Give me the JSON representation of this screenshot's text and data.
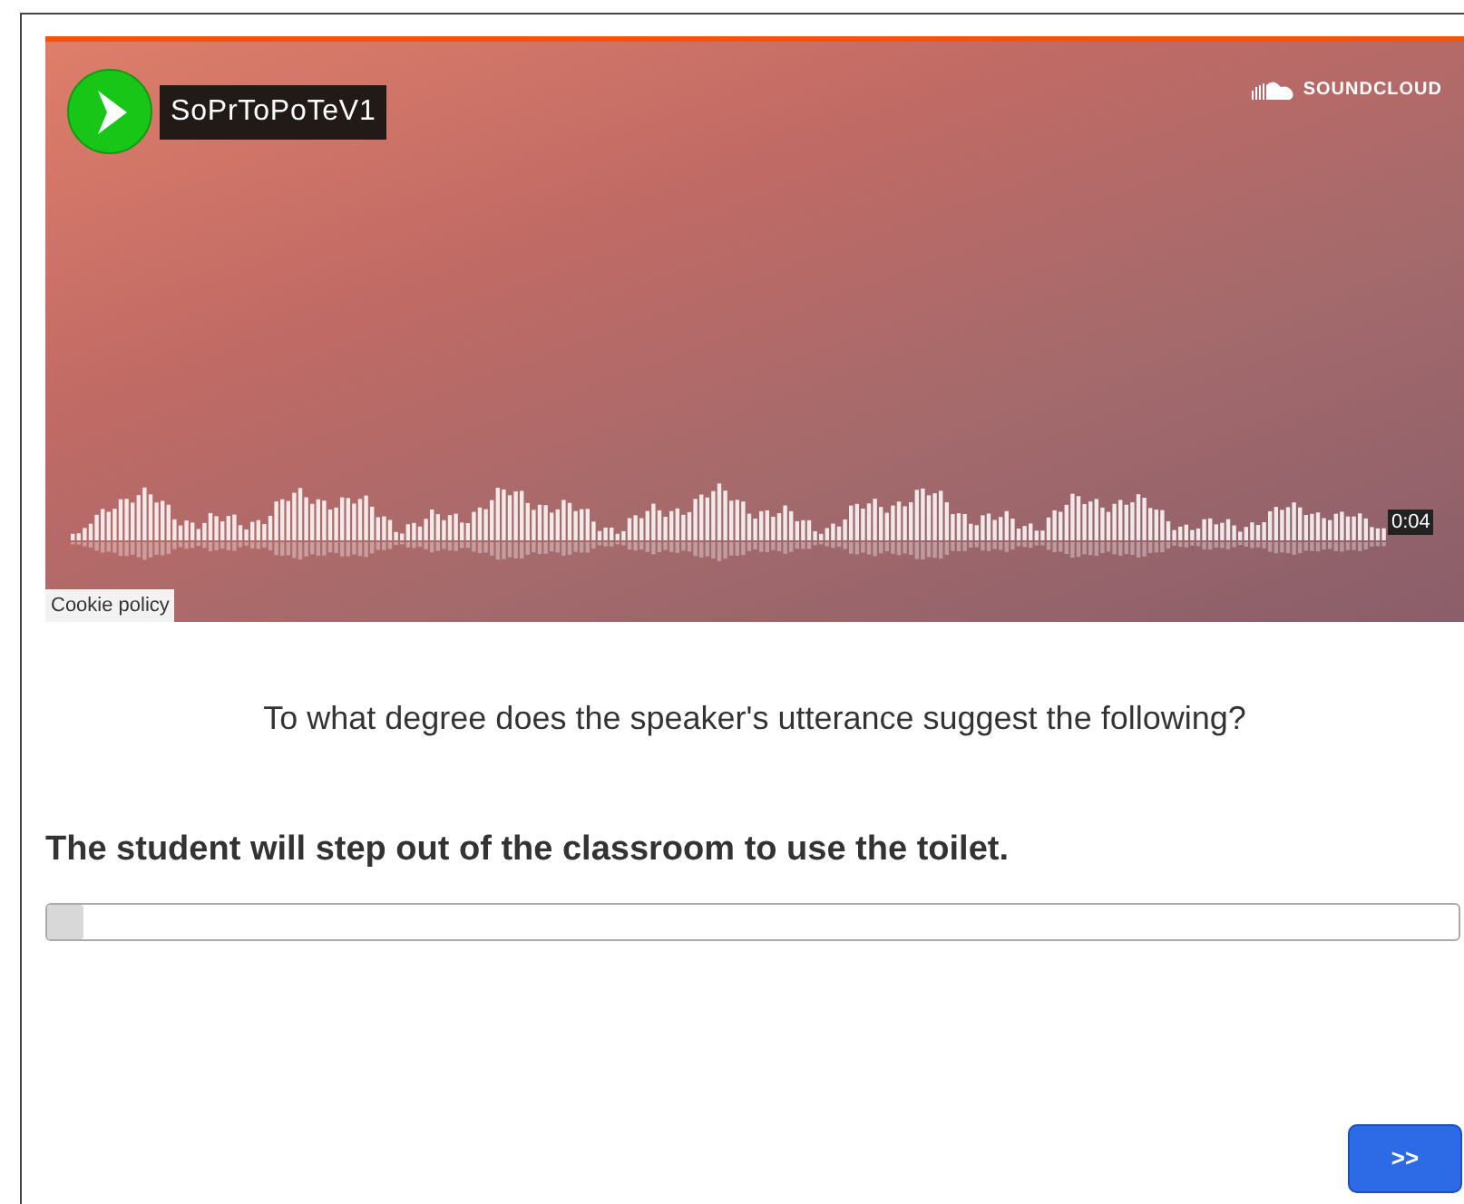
{
  "player": {
    "title": "SoPrToPoTeV1",
    "brand": "SOUNDCLOUD",
    "time": "0:04",
    "cookie_link": "Cookie policy"
  },
  "question": "To what degree does the speaker's utterance suggest the following?",
  "statement": "The student will step out of the classroom to use the toilet.",
  "slider": {
    "level": 0
  },
  "next_button": ">>"
}
